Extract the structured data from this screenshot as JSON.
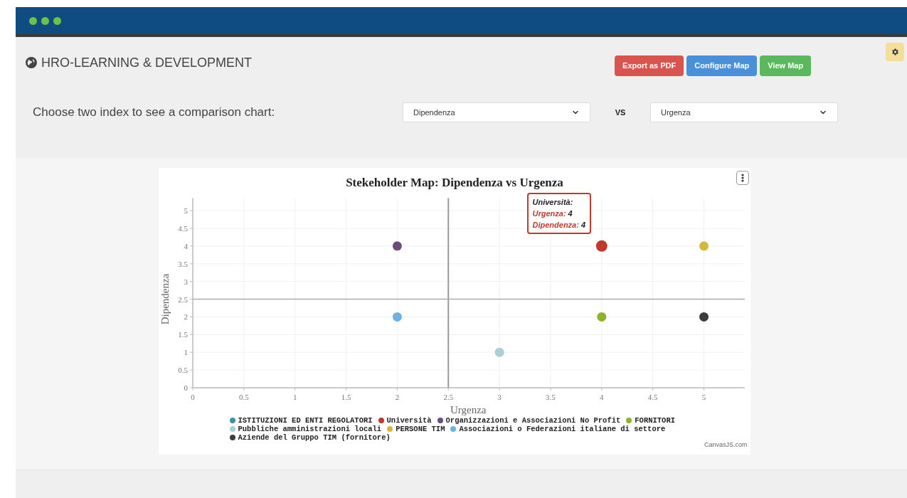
{
  "header": {
    "title": "HRO-LEARNING & DEVELOPMENT",
    "buttons": [
      {
        "label": "Export as PDF",
        "kind": "danger"
      },
      {
        "label": "Configure Map",
        "kind": "primary"
      },
      {
        "label": "View Map",
        "kind": "success"
      }
    ]
  },
  "comparison": {
    "prompt": "Choose two index to see a comparison chart:",
    "first": "Dipendenza",
    "separator": "VS",
    "second": "Urgenza"
  },
  "chart": {
    "tooltip": {
      "title": "Università:",
      "rows": [
        {
          "label": "Urgenza:",
          "value": "4"
        },
        {
          "label": "Dipendenza:",
          "value": "4"
        }
      ]
    },
    "credit": "CanvasJS.com",
    "chart_data": {
      "type": "scatter",
      "title": "Stekeholder Map: Dipendenza vs Urgenza",
      "xlabel": "Urgenza",
      "ylabel": "Dipendenza",
      "xlim": [
        0,
        5.4
      ],
      "ylim": [
        0,
        5.35
      ],
      "xticks": [
        0,
        0.5,
        1,
        1.5,
        2,
        2.5,
        3,
        3.5,
        4,
        4.5,
        5
      ],
      "yticks": [
        0,
        0.5,
        1,
        1.5,
        2,
        2.5,
        3,
        3.5,
        4,
        4.5,
        5
      ],
      "grid": true,
      "ref_lines": [
        {
          "axis": "x",
          "value": 2.5
        },
        {
          "axis": "y",
          "value": 2.5
        }
      ],
      "x": [
        2,
        3,
        4,
        5
      ],
      "series": [
        {
          "name": "ISTITUZIONI ED ENTI REGOLATORI",
          "color": "#3a93a8",
          "values": [
            null,
            null,
            null,
            null
          ]
        },
        {
          "name": "Università",
          "color": "#c0392b",
          "values": [
            null,
            null,
            4,
            null
          ]
        },
        {
          "name": "Organizzazioni e Associazioni No Profit",
          "color": "#6b4c7a",
          "values": [
            4,
            null,
            null,
            null
          ]
        },
        {
          "name": "FORNITORI",
          "color": "#8db32c",
          "values": [
            null,
            null,
            2,
            null
          ]
        },
        {
          "name": "Pubbliche amministrazioni locali",
          "color": "#a8d0d6",
          "values": [
            null,
            1,
            null,
            null
          ]
        },
        {
          "name": "PERSONE TIM",
          "color": "#d4b83a",
          "values": [
            null,
            null,
            null,
            4
          ]
        },
        {
          "name": "Associazioni o Federazioni italiane di settore",
          "color": "#6cb2e4",
          "values": [
            2,
            null,
            null,
            null
          ]
        },
        {
          "name": "Aziende del Gruppo TIM (fornitore)",
          "color": "#3d3d3d",
          "values": [
            null,
            null,
            null,
            2
          ]
        }
      ]
    }
  }
}
